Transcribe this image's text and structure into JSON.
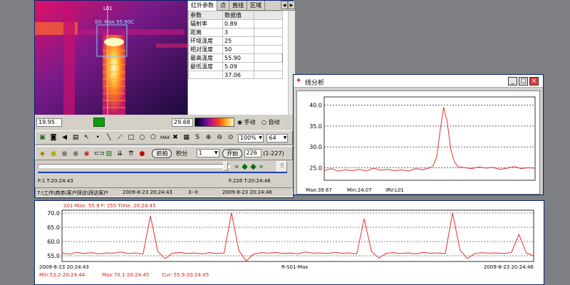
{
  "thermal": {
    "roi_label": "L01",
    "roi_readout": "S0: Max 55.90C"
  },
  "params_tabs": [
    "红外参数",
    "点",
    "直线",
    "区域"
  ],
  "params_table": {
    "headers": [
      "参数",
      "数据值"
    ],
    "rows": [
      [
        "辐射率",
        "0.89"
      ],
      [
        "距离",
        "3"
      ],
      [
        "环境温度",
        "25"
      ],
      [
        "相对湿度",
        "50"
      ],
      [
        "最高温度",
        "55.90"
      ],
      [
        "最低温度",
        "5.09"
      ],
      [
        "",
        "37.06"
      ]
    ]
  },
  "palette_bar": {
    "min_value": "19.95",
    "max_value": "29.68",
    "mode_manual": "手动",
    "mode_auto": "自动"
  },
  "toolbar": {
    "zoom_value": "100%",
    "depth_value": "64"
  },
  "capture": {
    "capture_button": "抓拍",
    "integrate_label": "积分",
    "integrate_value": "1",
    "start_button": "开始",
    "frame_value": "226",
    "frame_range": "(1-227)"
  },
  "timeline": {
    "start_label": "F:1 T:20:24:43",
    "end_label": "F:226 T:20:24:46"
  },
  "status_bar": {
    "path": "7:\\工作\\商务\\客户拜访\\拜访客户",
    "date_start": "2009-8-23 20:24:43",
    "frame_counter": "3--0",
    "date_end": "2009-8-23 20:24:46"
  },
  "analysis": {
    "title": "线分析",
    "footer_max": "Max:39.67",
    "footer_min": "Min:24.07",
    "footer_id": "IRV:L01"
  },
  "trend": {
    "header": "S01-Max: 55.9 F: 155 Time: 20:24:45",
    "x_start": "2009-8-23 20:24:43",
    "x_center": "R-S01-Max",
    "x_end": "2009-8-23 20:24:46",
    "summary_min": "Min:53.2-20:24:44",
    "summary_max": "Max:70.1-20:24:45",
    "summary_cur": "Cur: 55.9-20:24:45"
  },
  "chart_data": [
    {
      "type": "line",
      "title": "",
      "ylim": [
        22,
        42
      ],
      "y_ticks": [
        "25.0",
        "30.0",
        "35.0",
        "40.0"
      ],
      "x": [
        0,
        10,
        20,
        30,
        40,
        50,
        60,
        70,
        80,
        90,
        100,
        110,
        120,
        130,
        140,
        150,
        155,
        160,
        165,
        170,
        175,
        180,
        185,
        190,
        200,
        210,
        220,
        230,
        240,
        250,
        260,
        270,
        280,
        290,
        300
      ],
      "values": [
        24.3,
        24.8,
        24.2,
        24.5,
        24.3,
        24.6,
        24.2,
        24.9,
        24.4,
        24.6,
        24.3,
        24.5,
        24.2,
        24.8,
        24.5,
        25.0,
        25.5,
        27.5,
        34.0,
        39.5,
        36.0,
        29.5,
        26.5,
        25.3,
        25.0,
        24.8,
        25.2,
        24.9,
        25.1,
        24.6,
        24.9,
        25.3,
        24.8,
        25.0,
        24.9
      ],
      "series_color": "#e53030"
    },
    {
      "type": "line",
      "title": "S01-Max: 55.9 F: 155 Time: 20:24:45",
      "xlabel": "R-S01-Max",
      "ylim": [
        53,
        71
      ],
      "y_ticks": [
        "55.0",
        "60.0",
        "65.0",
        "70.0"
      ],
      "x": [
        0,
        10,
        20,
        30,
        40,
        50,
        60,
        70,
        80,
        90,
        100,
        110,
        120,
        130,
        140,
        150,
        160,
        170,
        180,
        190,
        200,
        210,
        220,
        230,
        240,
        250,
        260,
        270,
        280,
        290,
        300,
        310,
        320,
        330,
        340,
        350,
        360,
        370,
        380,
        390,
        400,
        410,
        420,
        430,
        440,
        450,
        460,
        470,
        480,
        490,
        500,
        510,
        520,
        530,
        540,
        550,
        560,
        570,
        580,
        590,
        600,
        610,
        620,
        630,
        640
      ],
      "values": [
        56.0,
        55.6,
        56.2,
        55.8,
        56.1,
        55.7,
        56.0,
        55.9,
        56.3,
        55.8,
        56.0,
        55.6,
        69.0,
        56.5,
        54.0,
        55.9,
        56.2,
        55.8,
        56.0,
        55.7,
        56.1,
        55.8,
        56.0,
        70.1,
        56.8,
        53.2,
        55.6,
        56.1,
        55.9,
        56.2,
        55.8,
        56.0,
        55.7,
        56.3,
        55.9,
        56.0,
        55.8,
        56.2,
        55.9,
        56.0,
        55.7,
        68.0,
        56.5,
        54.2,
        55.9,
        56.1,
        55.8,
        56.0,
        55.7,
        56.2,
        55.9,
        56.0,
        55.8,
        70.0,
        57.0,
        54.0,
        55.8,
        56.1,
        55.9,
        56.0,
        55.8,
        56.2,
        62.5,
        56.0,
        55.0
      ],
      "series_color": "#e53030"
    }
  ],
  "colors": {
    "window_bg": "#d4d0c8",
    "title_blue": "#0a246a",
    "series_red": "#e53030",
    "desktop": "#7d7f83"
  }
}
